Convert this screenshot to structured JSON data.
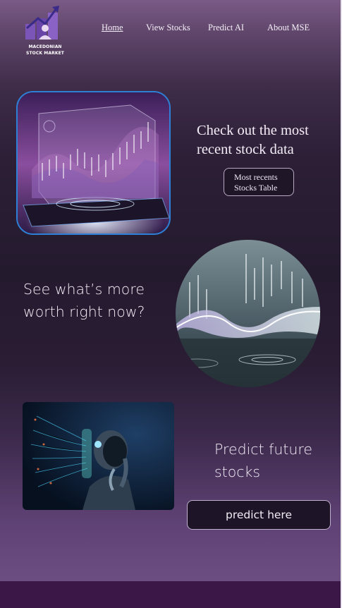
{
  "logo": {
    "line1": "MACEDONIAN",
    "line2": "STOCK MARKET"
  },
  "nav": [
    {
      "label": "Home",
      "active": true
    },
    {
      "label": "View Stocks",
      "active": false
    },
    {
      "label": "Predict AI",
      "active": false
    },
    {
      "label": "About MSE",
      "active": false
    }
  ],
  "sections": {
    "recent": {
      "heading": "Check out the most recent stock data",
      "button": "Most recents Stocks Table"
    },
    "worth": {
      "heading": "See what’s more worth right now?"
    },
    "predict": {
      "heading": "Predict future stocks",
      "button": "predict here"
    }
  },
  "colors": {
    "accent": "#2e7fd6",
    "footer": "#3b1748",
    "background_top": "#7a5a86",
    "background_mid": "#241a2e"
  }
}
